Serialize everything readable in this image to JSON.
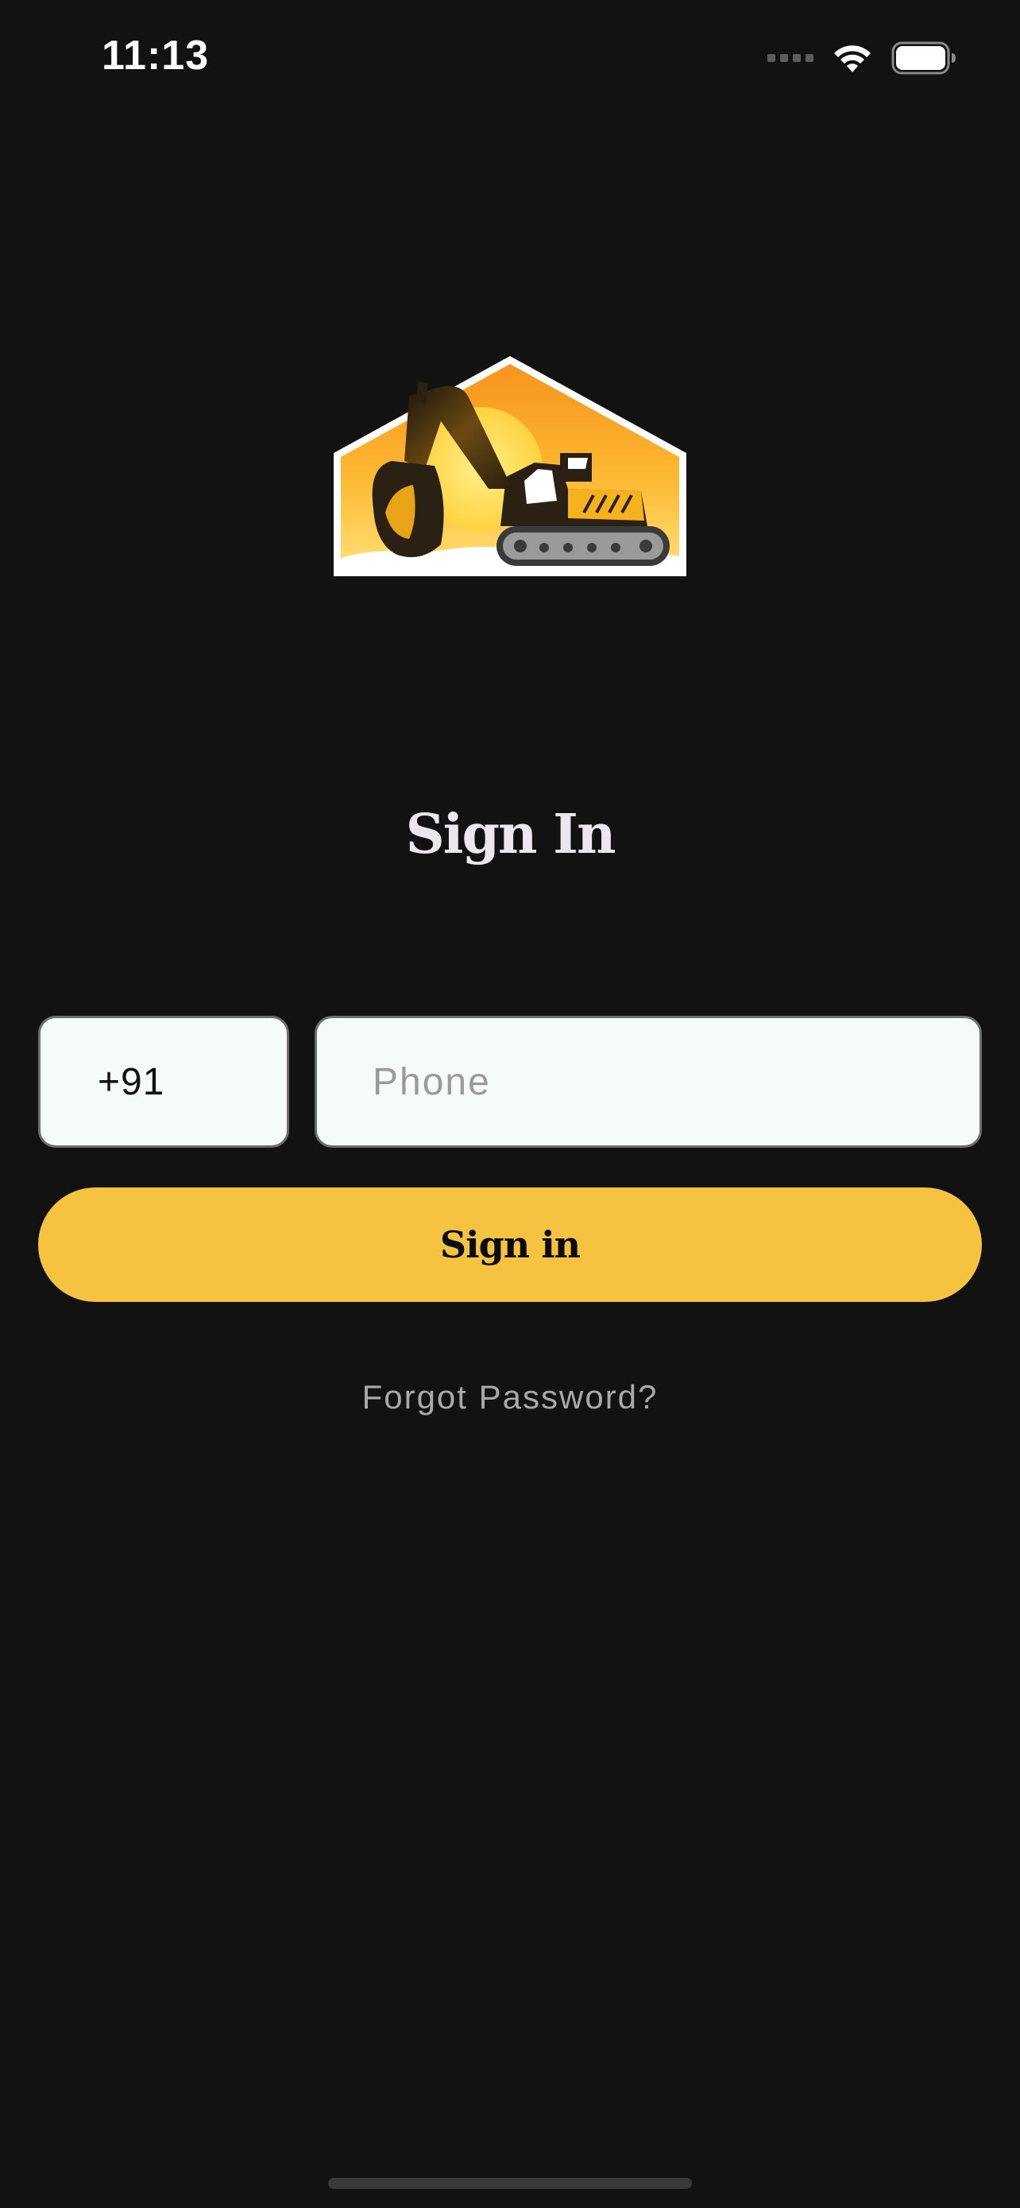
{
  "status_bar": {
    "time": "11:13",
    "icons": [
      "cellular-signal-icon",
      "wifi-icon",
      "battery-icon"
    ]
  },
  "logo": {
    "name": "excavator-logo",
    "colors": {
      "badge_gradient_top": "#f7941d",
      "badge_gradient_bottom": "#ffe066",
      "machine": "#2a2114"
    }
  },
  "title": "Sign In",
  "form": {
    "country_code": "+91",
    "phone_placeholder": "Phone",
    "phone_value": ""
  },
  "signin_button_label": "Sign in",
  "forgot_password_label": "Forgot Password?",
  "colors": {
    "background": "#121212",
    "accent": "#f6c341",
    "input_background": "#f4fbf8",
    "muted_text": "#a9a9a9"
  }
}
